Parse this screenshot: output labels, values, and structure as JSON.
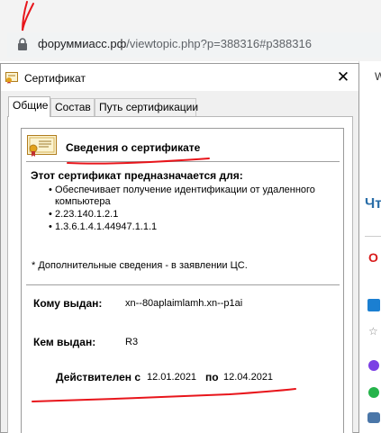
{
  "browser": {
    "url_host": "форуммиасс.рф",
    "url_path": "/viewtopic.php?p=388316#p388316"
  },
  "right_strip": {
    "top_text": "W",
    "mid_text": "Что",
    "red_text": "О"
  },
  "dialog": {
    "title": "Сертификат",
    "close_glyph": "✕",
    "tabs": [
      {
        "label": "Общие",
        "active": true
      },
      {
        "label": "Состав",
        "active": false
      },
      {
        "label": "Путь сертификации",
        "active": false
      }
    ],
    "heading": "Сведения о сертификате",
    "purpose_title": "Этот сертификат предназначается для:",
    "purposes": [
      "Обеспечивает получение идентификации от удаленного компьютера",
      "2.23.140.1.2.1",
      "1.3.6.1.4.1.44947.1.1.1"
    ],
    "additional_note": "* Дополнительные сведения - в заявлении ЦС.",
    "issued_to_label": "Кому выдан:",
    "issued_to_value": "xn--80aplaimlamh.xn--p1ai",
    "issued_by_label": "Кем выдан:",
    "issued_by_value": "R3",
    "valid_from_label": "Действителен с",
    "valid_from": "12.01.2021",
    "valid_to_label": "по",
    "valid_to": "12.04.2021"
  },
  "colors": {
    "annotation_red": "#e8151b",
    "lock": "#5f6368",
    "url_text": "#202124",
    "tab_border": "#b8b8b8"
  }
}
